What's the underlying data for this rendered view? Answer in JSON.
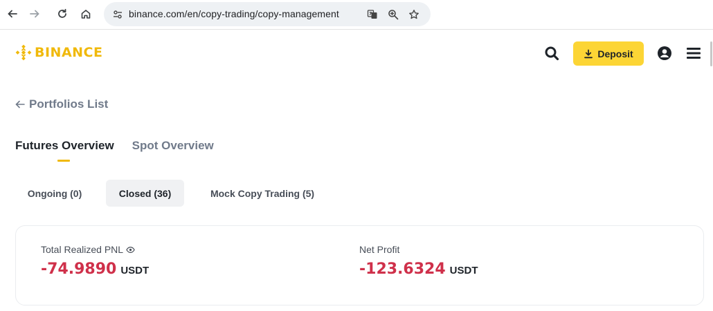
{
  "browser": {
    "url": "binance.com/en/copy-trading/copy-management"
  },
  "header": {
    "logo_text": "BINANCE",
    "deposit_label": "Deposit",
    "brand_color": "#f0b90b",
    "accent_button_color": "#fcd535"
  },
  "back_link": {
    "label": "Portfolios List"
  },
  "overview_tabs": [
    {
      "label": "Futures Overview",
      "active": true
    },
    {
      "label": "Spot Overview",
      "active": false
    }
  ],
  "status_tabs": [
    {
      "label": "Ongoing (0)",
      "active": false
    },
    {
      "label": "Closed (36)",
      "active": true
    },
    {
      "label": "Mock Copy Trading (5)",
      "active": false
    }
  ],
  "summary": {
    "total_realized_pnl": {
      "label": "Total Realized PNL",
      "value": "-74.9890",
      "unit": "USDT"
    },
    "net_profit": {
      "label": "Net Profit",
      "value": "-123.6324",
      "unit": "USDT"
    },
    "negative_color": "#cf304a"
  }
}
